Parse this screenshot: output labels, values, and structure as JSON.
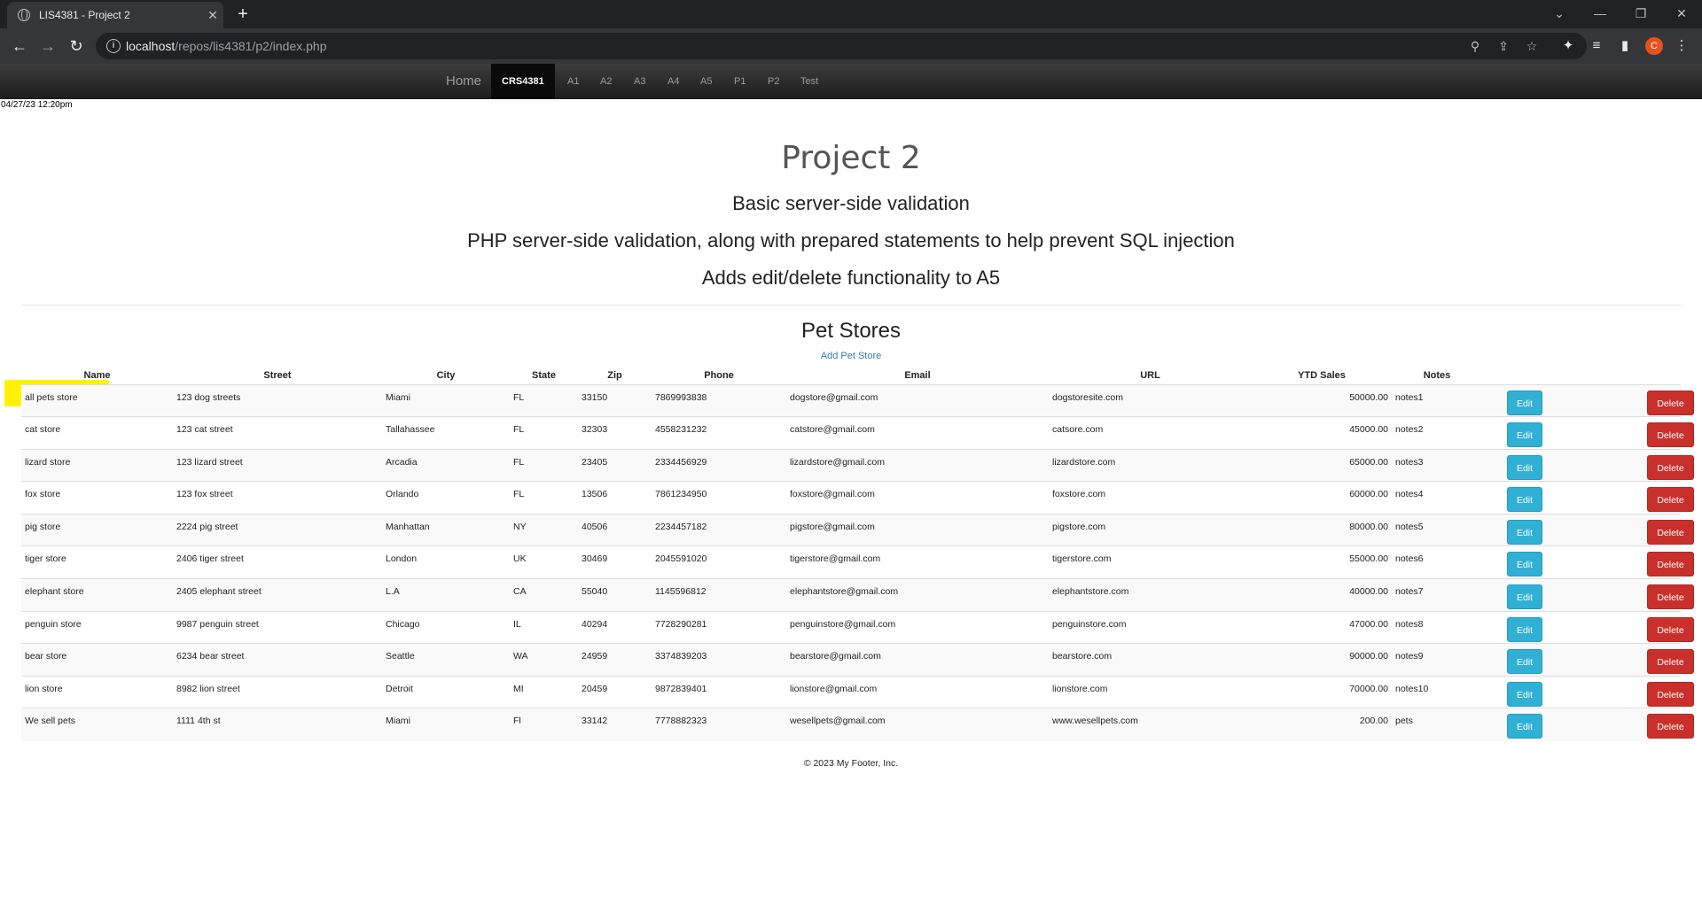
{
  "browser": {
    "tab_title": "LIS4381 - Project 2",
    "url_host": "localhost",
    "url_path": "/repos/lis4381/p2/index.php",
    "profile_initial": "C"
  },
  "nav": {
    "brand": "Home",
    "active": "CRS4381",
    "links": [
      "A1",
      "A2",
      "A3",
      "A4",
      "A5",
      "P1",
      "P2",
      "Test"
    ]
  },
  "timestamp": "04/27/23 12:20pm",
  "page": {
    "title": "Project 2",
    "subtitle1": "Basic server-side validation",
    "subtitle2": "PHP server-side validation, along with prepared statements to help prevent SQL injection",
    "subtitle3": "Adds edit/delete functionality to A5",
    "section_title": "Pet Stores",
    "add_link": "Add Pet Store"
  },
  "table": {
    "headers": [
      "Name",
      "Street",
      "City",
      "State",
      "Zip",
      "Phone",
      "Email",
      "URL",
      "YTD Sales",
      "Notes"
    ],
    "edit_label": "Edit",
    "delete_label": "Delete",
    "rows": [
      [
        "all pets store",
        "123 dog streets",
        "Miami",
        "FL",
        "33150",
        "7869993838",
        "dogstore@gmail.com",
        "dogstoresite.com",
        "50000.00",
        "notes1"
      ],
      [
        "cat store",
        "123 cat street",
        "Tallahassee",
        "FL",
        "32303",
        "4558231232",
        "catstore@gmail.com",
        "catsore.com",
        "45000.00",
        "notes2"
      ],
      [
        "lizard store",
        "123 lizard street",
        "Arcadia",
        "FL",
        "23405",
        "2334456929",
        "lizardstore@gmail.com",
        "lizardstore.com",
        "65000.00",
        "notes3"
      ],
      [
        "fox store",
        "123 fox street",
        "Orlando",
        "FL",
        "13506",
        "7861234950",
        "foxstore@gmail.com",
        "foxstore.com",
        "60000.00",
        "notes4"
      ],
      [
        "pig store",
        "2224 pig street",
        "Manhattan",
        "NY",
        "40506",
        "2234457182",
        "pigstore@gmail.com",
        "pigstore.com",
        "80000.00",
        "notes5"
      ],
      [
        "tiger store",
        "2406 tiger street",
        "London",
        "UK",
        "30469",
        "2045591020",
        "tigerstore@gmail.com",
        "tigerstore.com",
        "55000.00",
        "notes6"
      ],
      [
        "elephant store",
        "2405 elephant street",
        "L.A",
        "CA",
        "55040",
        "1145596812",
        "elephantstore@gmail.com",
        "elephantstore.com",
        "40000.00",
        "notes7"
      ],
      [
        "penguin store",
        "9987 penguin street",
        "Chicago",
        "IL",
        "40294",
        "7728290281",
        "penguinstore@gmail.com",
        "penguinstore.com",
        "47000.00",
        "notes8"
      ],
      [
        "bear store",
        "6234 bear street",
        "Seattle",
        "WA",
        "24959",
        "3374839203",
        "bearstore@gmail.com",
        "bearstore.com",
        "90000.00",
        "notes9"
      ],
      [
        "lion store",
        "8982 lion street",
        "Detroit",
        "MI",
        "20459",
        "9872839401",
        "lionstore@gmail.com",
        "lionstore.com",
        "70000.00",
        "notes10"
      ],
      [
        "We sell pets",
        "1111 4th st",
        "Miami",
        "Fl",
        "33142",
        "7778882323",
        "wesellpets@gmail.com",
        "www.wesellpets.com",
        "200.00",
        "pets"
      ]
    ]
  },
  "footer": "© 2023 My Footer, Inc."
}
